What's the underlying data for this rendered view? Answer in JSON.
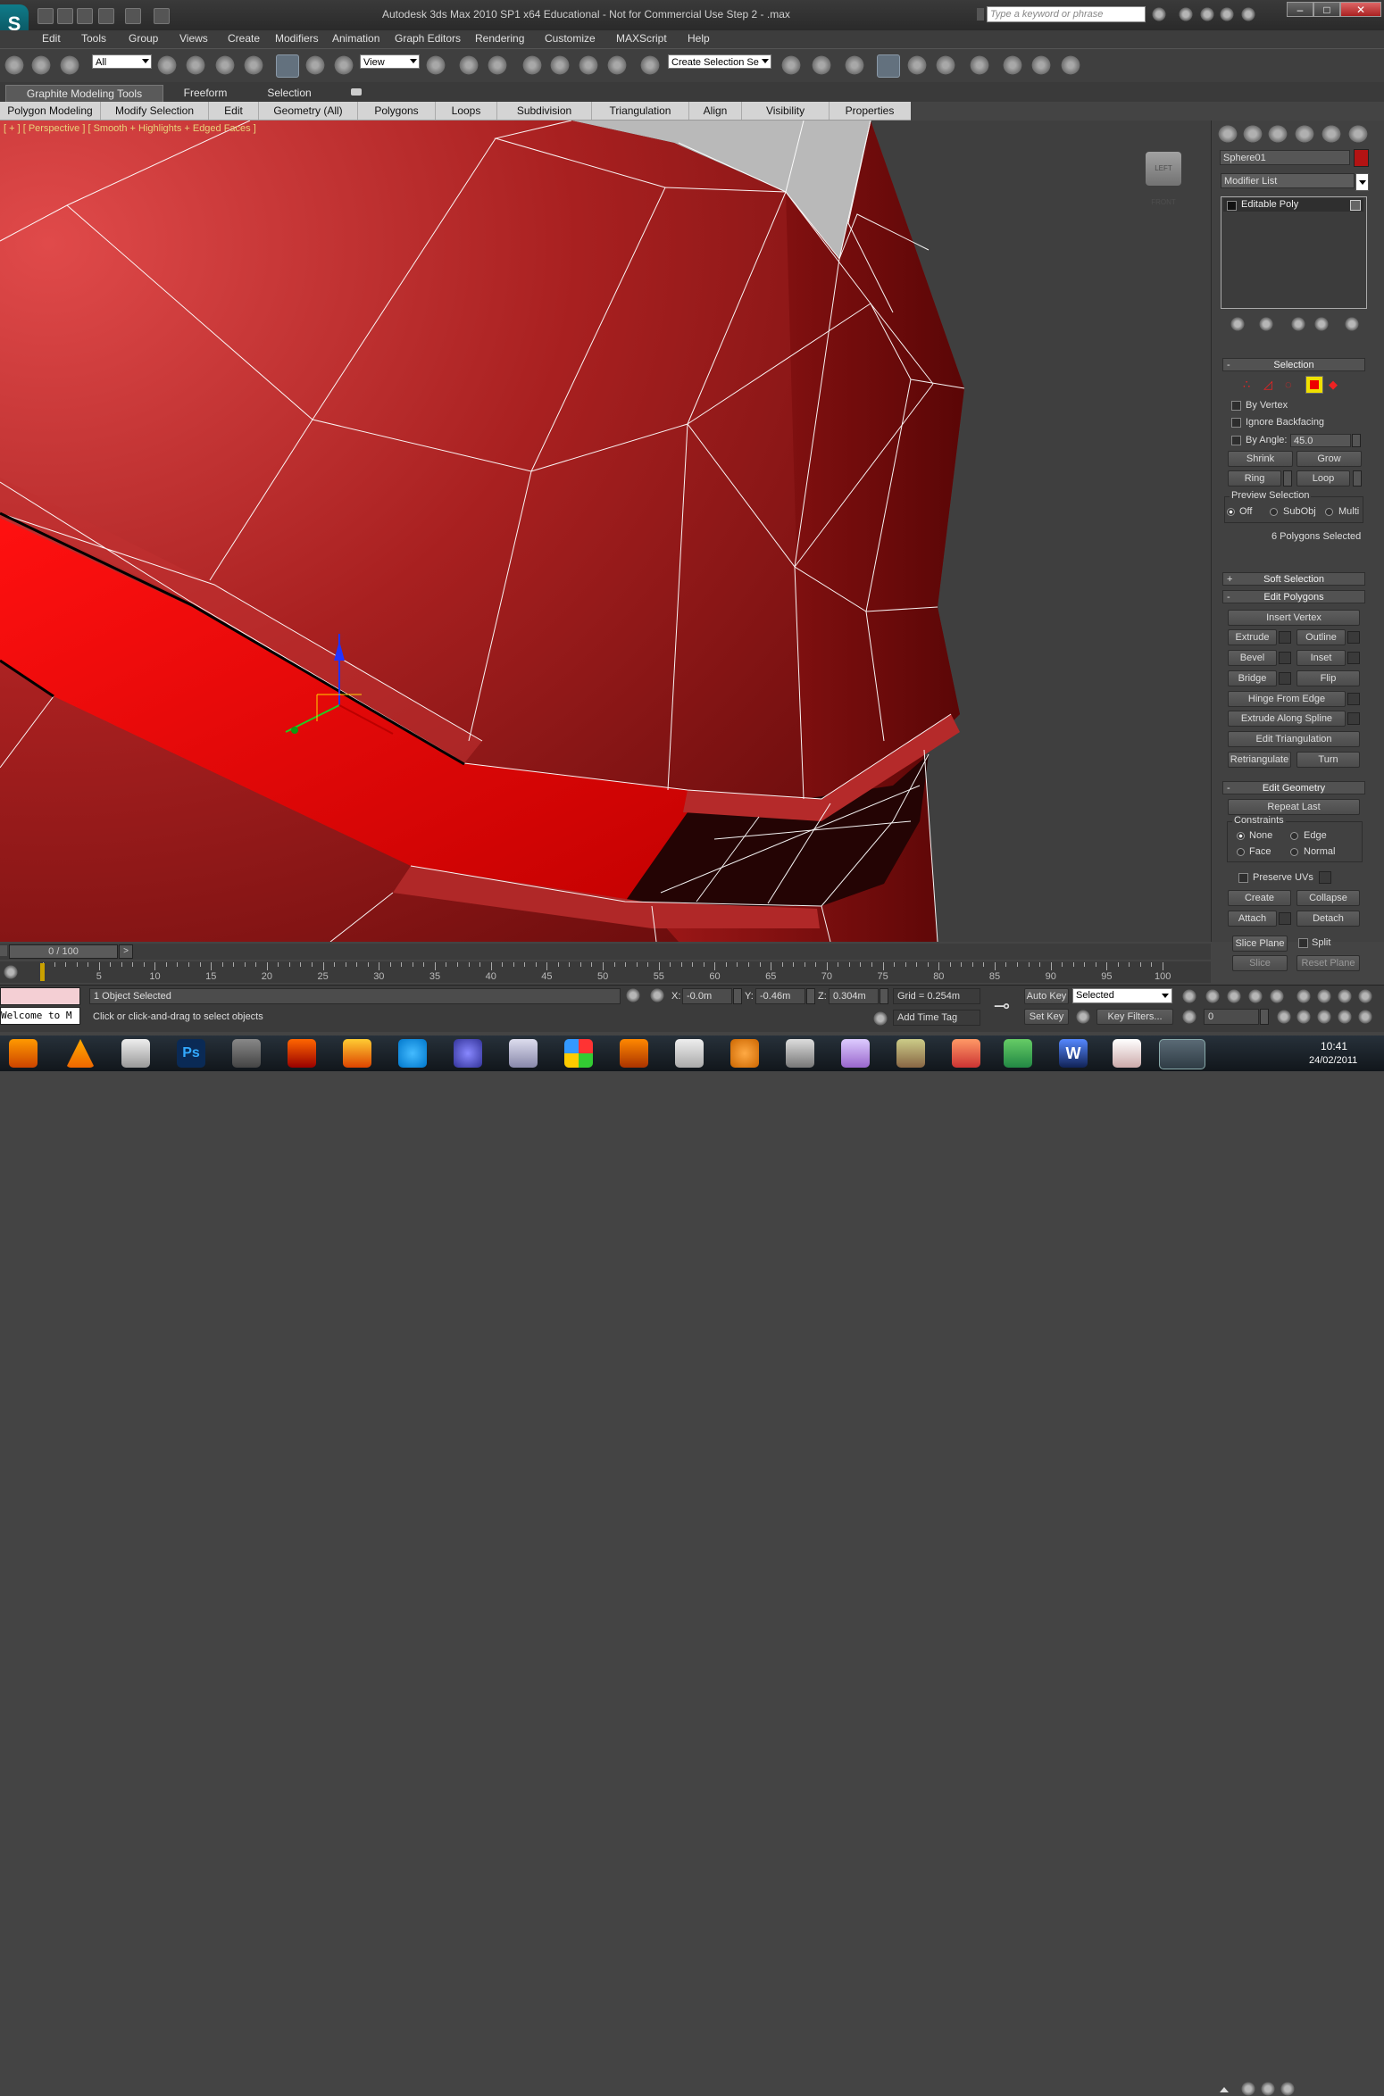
{
  "window": {
    "title": "Autodesk 3ds Max  2010 SP1 x64   Educational - Not for Commercial Use      Step 2 - .max",
    "search_placeholder": "Type a keyword or phrase",
    "minimize": "–",
    "maximize": "□",
    "close": "✕"
  },
  "menu": [
    "Edit",
    "Tools",
    "Group",
    "Views",
    "Create",
    "Modifiers",
    "Animation",
    "Graph Editors",
    "Rendering",
    "Customize",
    "MAXScript",
    "Help"
  ],
  "toolbar": {
    "selection_filter": "All",
    "reference_coord": "View",
    "named_selection": "Create Selection Se"
  },
  "ribbon": {
    "tabs": [
      "Graphite Modeling Tools",
      "Freeform",
      "Selection"
    ],
    "panels": [
      "Polygon Modeling",
      "Modify Selection",
      "Edit",
      "Geometry (All)",
      "Polygons",
      "Loops",
      "Subdivision",
      "Triangulation",
      "Align",
      "Visibility",
      "Properties"
    ]
  },
  "viewport": {
    "label": "[ + ] [ Perspective ] [ Smooth + Highlights + Edged Faces ]",
    "cube_text": "LEFT  FRONT"
  },
  "command_panel": {
    "object_name": "Sphere01",
    "object_color": "#b31313",
    "modifier_list": "Modifier List",
    "stack": [
      "Editable Poly"
    ],
    "selection": {
      "title": "Selection",
      "by_vertex": "By Vertex",
      "ignore_backfacing": "Ignore Backfacing",
      "by_angle": "By Angle:",
      "angle_value": "45.0",
      "shrink": "Shrink",
      "grow": "Grow",
      "ring": "Ring",
      "loop": "Loop",
      "preview_title": "Preview Selection",
      "preview_off": "Off",
      "preview_subobj": "SubObj",
      "preview_multi": "Multi",
      "status": "6 Polygons Selected"
    },
    "soft_selection": "Soft Selection",
    "edit_polygons": {
      "title": "Edit Polygons",
      "insert_vertex": "Insert Vertex",
      "extrude": "Extrude",
      "outline": "Outline",
      "bevel": "Bevel",
      "inset": "Inset",
      "bridge": "Bridge",
      "flip": "Flip",
      "hinge_from_edge": "Hinge From Edge",
      "extrude_along_spline": "Extrude Along Spline",
      "edit_triangulation": "Edit Triangulation",
      "retriangulate": "Retriangulate",
      "turn": "Turn"
    },
    "edit_geometry": {
      "title": "Edit Geometry",
      "repeat_last": "Repeat Last",
      "constraints": "Constraints",
      "none": "None",
      "edge": "Edge",
      "face": "Face",
      "normal": "Normal",
      "preserve_uvs": "Preserve UVs",
      "create": "Create",
      "collapse": "Collapse",
      "attach": "Attach",
      "detach": "Detach",
      "slice_plane": "Slice Plane",
      "split": "Split",
      "slice": "Slice",
      "reset_plane": "Reset Plane"
    }
  },
  "timeline": {
    "frame": "0 / 100",
    "progress": 0,
    "ticks": [
      "5",
      "10",
      "15",
      "20",
      "25",
      "30",
      "35",
      "40",
      "45",
      "50",
      "55",
      "60",
      "65",
      "70",
      "75",
      "80",
      "85",
      "90",
      "95",
      "100"
    ]
  },
  "status": {
    "maxscript_listener": "Welcome to M",
    "selected_count": "1 Object Selected",
    "prompt": "Click or click-and-drag to select objects",
    "x_label": "X:",
    "x": "-0.0m",
    "y_label": "Y:",
    "y": "-0.46m",
    "z_label": "Z:",
    "z": "0.304m",
    "grid": "Grid = 0.254m",
    "add_time_tag": "Add Time Tag",
    "auto_key": "Auto Key",
    "set_key": "Set Key",
    "key_mode": "Selected",
    "key_filters": "Key Filters...",
    "current_frame": "0"
  },
  "taskbar": {
    "time": "10:41",
    "date": "24/02/2011",
    "app_ps": "Ps",
    "app_w": "W"
  }
}
